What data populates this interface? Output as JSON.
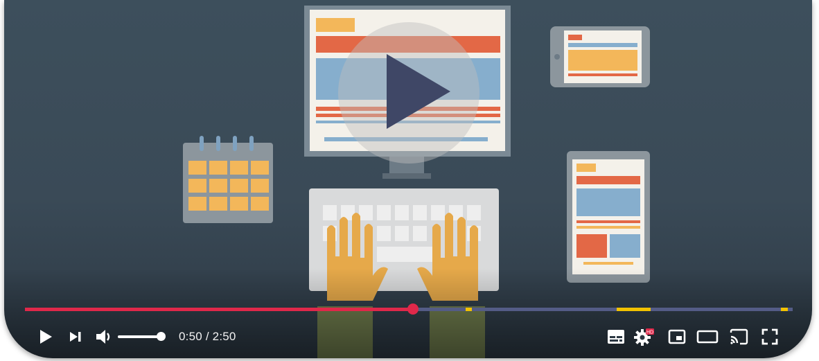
{
  "player": {
    "time_current": "0:50",
    "time_separator": " / ",
    "time_total": "2:50",
    "progress": {
      "played_fraction": 0.505,
      "chapters": [
        {
          "start": 0.574,
          "end": 0.582
        },
        {
          "start": 0.771,
          "end": 0.815
        },
        {
          "start": 0.985,
          "end": 0.994
        }
      ]
    },
    "volume_level": 1.0,
    "autoplay_badge": "HD",
    "colors": {
      "accent": "#e0284a",
      "track": "#545c86",
      "chapter": "#f2c200"
    }
  },
  "icons": {
    "play": "play-icon",
    "next": "next-icon",
    "volume": "volume-icon",
    "subtitles": "subtitles-icon",
    "settings": "gear-icon",
    "miniplayer": "miniplayer-icon",
    "theater": "theater-icon",
    "cast": "cast-icon",
    "fullscreen": "fullscreen-icon",
    "big_play": "big-play-icon"
  }
}
